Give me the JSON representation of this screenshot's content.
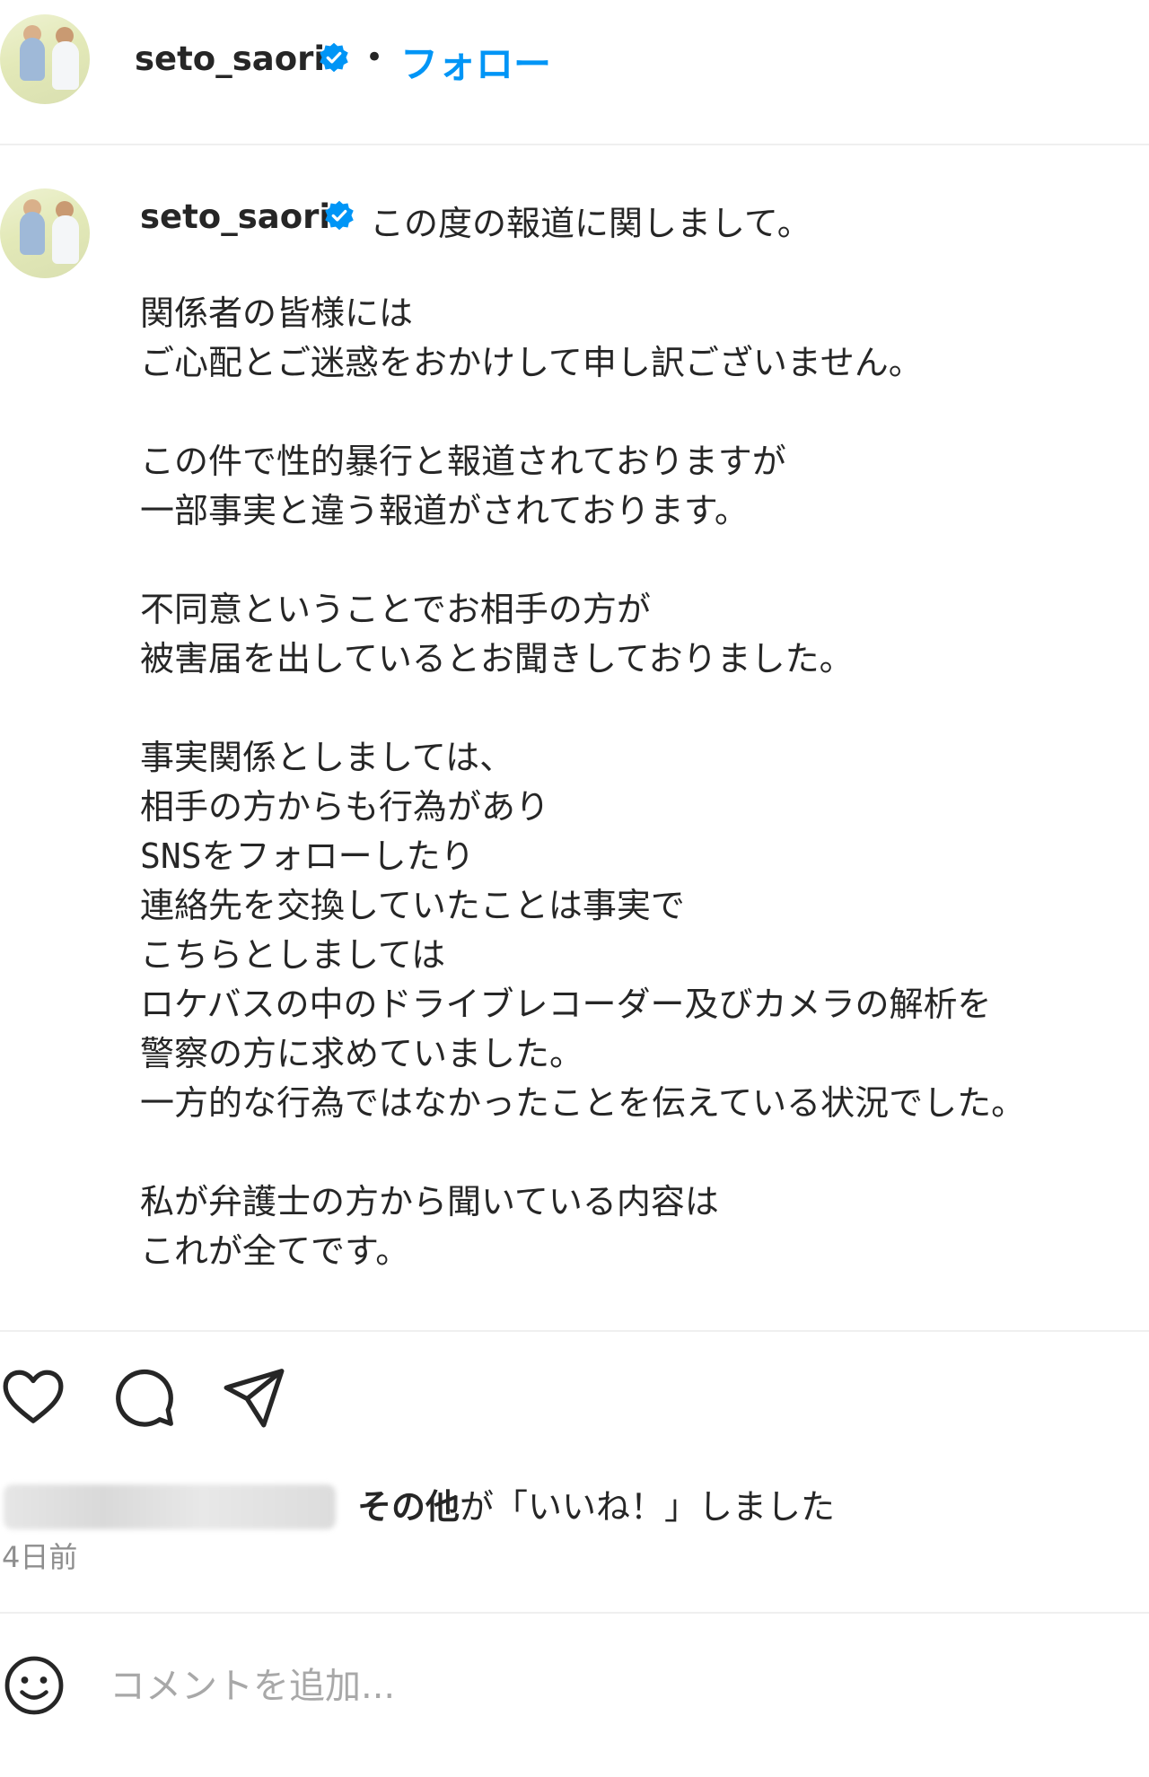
{
  "header": {
    "username": "seto_saori",
    "separator": "•",
    "follow_label": "フォロー"
  },
  "caption": {
    "username": "seto_saori",
    "first_line": "この度の報道に関しまして。",
    "body": "関係者の皆様には\nご心配とご迷惑をおかけして申し訳ございません。\n\nこの件で性的暴行と報道されておりますが\n一部事実と違う報道がされております。\n\n不同意ということでお相手の方が\n被害届を出しているとお聞きしておりました。\n\n事実関係としましては、\n相手の方からも行為があり\nSNSをフォローしたり\n連絡先を交換していたことは事実で\nこちらとしましては\nロケバスの中のドライブレコーダー及びカメラの解析を\n警察の方に求めていました。\n一方的な行為ではなかったことを伝えている状況でした。\n\n私が弁護士の方から聞いている内容は\nこれが全てです。"
  },
  "actions": {
    "icons": [
      "heart-icon",
      "comment-icon",
      "share-icon"
    ]
  },
  "likes": {
    "bold_text": "その他",
    "rest_text": "が「いいね！」しました"
  },
  "date": "4日前",
  "comment": {
    "placeholder": "コメントを追加..."
  },
  "colors": {
    "accent": "#0095f6",
    "text": "#262626",
    "muted": "#8e8e8e",
    "divider": "#efefef"
  }
}
